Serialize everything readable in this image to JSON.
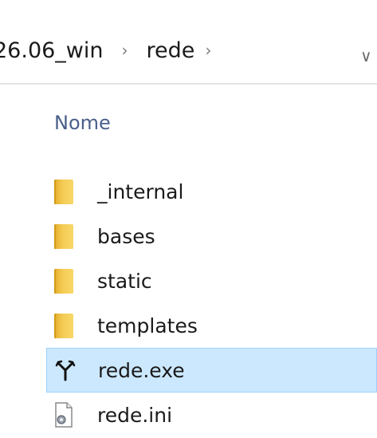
{
  "breadcrumb": {
    "parent": "26.06_win",
    "current": "rede"
  },
  "columns": {
    "name": "Nome"
  },
  "files": [
    {
      "name": "_internal",
      "type": "folder"
    },
    {
      "name": "bases",
      "type": "folder"
    },
    {
      "name": "static",
      "type": "folder"
    },
    {
      "name": "templates",
      "type": "folder"
    },
    {
      "name": "rede.exe",
      "type": "exe",
      "selected": true
    },
    {
      "name": "rede.ini",
      "type": "ini"
    }
  ],
  "icons": {
    "separator": "chevron-right-icon",
    "dropdown": "chevron-down-icon",
    "folder": "folder-icon",
    "exe": "application-icon",
    "ini": "settings-file-icon"
  },
  "colors": {
    "selection_background": "#cce8ff",
    "selection_border": "#99d1ff",
    "folder": "#f5cc55",
    "column_header": "#4a5f8b"
  }
}
